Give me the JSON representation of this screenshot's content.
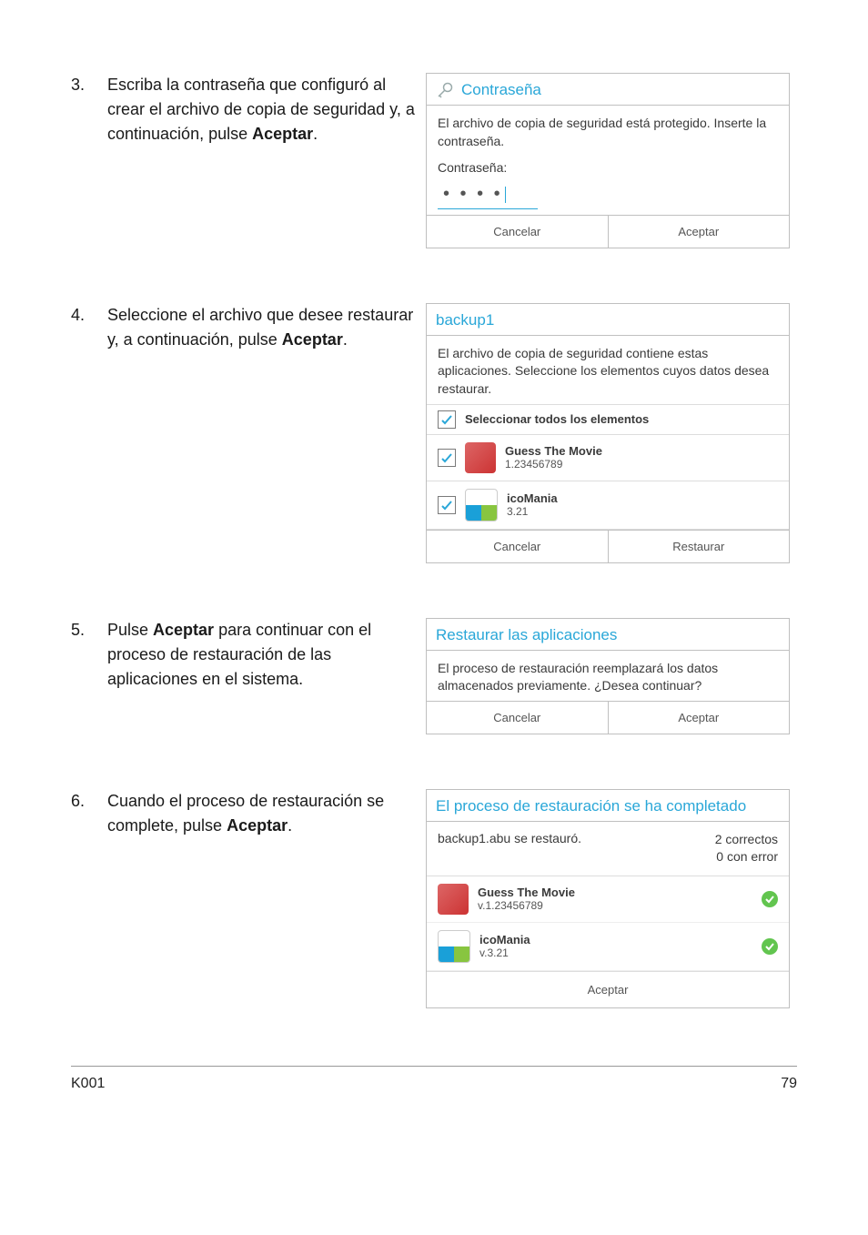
{
  "steps": {
    "s3": {
      "num": "3.",
      "text_pre": "Escriba la contraseña que configuró al crear el archivo de copia de seguridad y, a continuación, pulse ",
      "text_bold": "Aceptar",
      "text_post": "."
    },
    "s4": {
      "num": "4.",
      "text_pre": "Seleccione el archivo que desee restaurar y, a continuación, pulse ",
      "text_bold": "Aceptar",
      "text_post": "."
    },
    "s5": {
      "num": "5.",
      "text_pre": "Pulse ",
      "text_bold": "Aceptar",
      "text_post": " para continuar con el proceso de restauración de las aplicaciones en el sistema."
    },
    "s6": {
      "num": "6.",
      "text_pre": "Cuando el proceso de restauración se complete, pulse ",
      "text_bold": "Aceptar",
      "text_post": "."
    }
  },
  "dlg_password": {
    "title": "Contraseña",
    "body": "El archivo de copia de seguridad está protegido. Inserte la contraseña.",
    "label": "Contraseña:",
    "value": "• • • •",
    "cancel": "Cancelar",
    "ok": "Aceptar"
  },
  "dlg_backup": {
    "title": "backup1",
    "body": "El archivo de copia de seguridad contiene estas aplicaciones. Seleccione los elementos cuyos datos desea restaurar.",
    "select_all": "Seleccionar todos los elementos",
    "apps": [
      {
        "name": "Guess The Movie",
        "version": "1.23456789"
      },
      {
        "name": "icoMania",
        "version": "3.21"
      }
    ],
    "cancel": "Cancelar",
    "restore": "Restaurar"
  },
  "dlg_confirm": {
    "title": "Restaurar las aplicaciones",
    "body": "El proceso de restauración reemplazará los datos almacenados previamente. ¿Desea continuar?",
    "cancel": "Cancelar",
    "ok": "Aceptar"
  },
  "dlg_done": {
    "title": "El proceso de restauración se ha completado",
    "status_file": "backup1.abu se restauró.",
    "status_ok": "2 correctos",
    "status_err": "0 con error",
    "apps": [
      {
        "name": "Guess The Movie",
        "version": "v.1.23456789"
      },
      {
        "name": "icoMania",
        "version": "v.3.21"
      }
    ],
    "ok": "Aceptar"
  },
  "footer": {
    "model": "K001",
    "page": "79"
  }
}
